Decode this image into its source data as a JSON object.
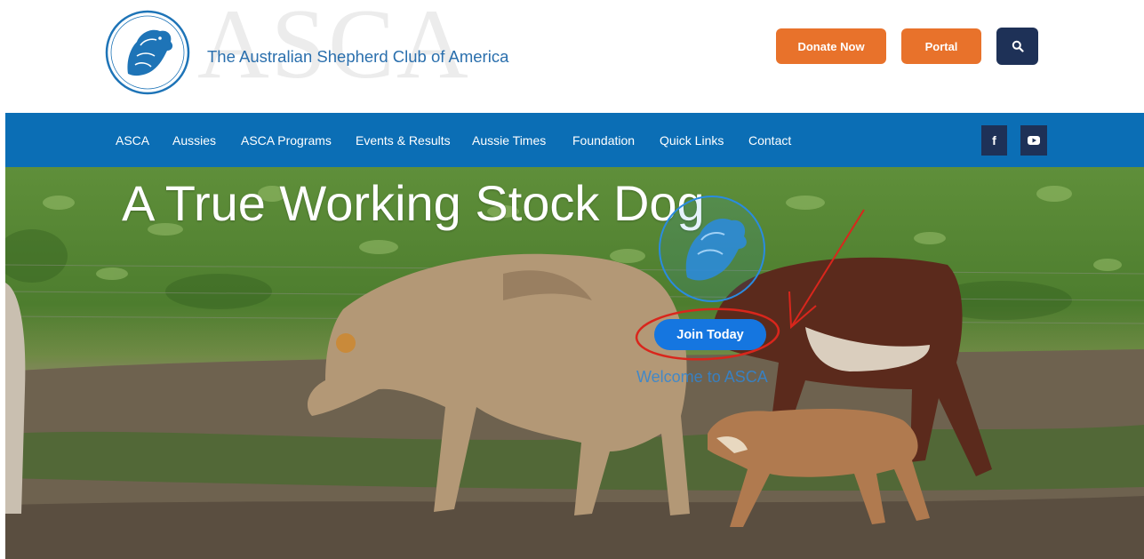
{
  "header": {
    "watermark": "ASCA",
    "site_title": "The Australian Shepherd Club of America",
    "donate_label": "Donate Now",
    "portal_label": "Portal",
    "search_icon": "search-icon"
  },
  "nav": {
    "items": [
      {
        "label": "ASCA"
      },
      {
        "label": "Aussies"
      },
      {
        "label": "ASCA Programs"
      },
      {
        "label": "Events & Results"
      },
      {
        "label": "Aussie Times"
      },
      {
        "label": "Foundation"
      },
      {
        "label": "Quick Links"
      },
      {
        "label": "Contact"
      }
    ],
    "social": [
      {
        "icon": "facebook-icon",
        "glyph": "f"
      },
      {
        "icon": "youtube-icon"
      }
    ]
  },
  "hero": {
    "title": "A True Working Stock Dog",
    "cta_label": "Join Today",
    "welcome_text": "Welcome to ASCA"
  },
  "colors": {
    "brand_blue": "#0b6eb5",
    "accent_orange": "#e8722b",
    "navy": "#1e3157",
    "cta_blue": "#1576e0",
    "annotation_red": "#d9261c"
  }
}
